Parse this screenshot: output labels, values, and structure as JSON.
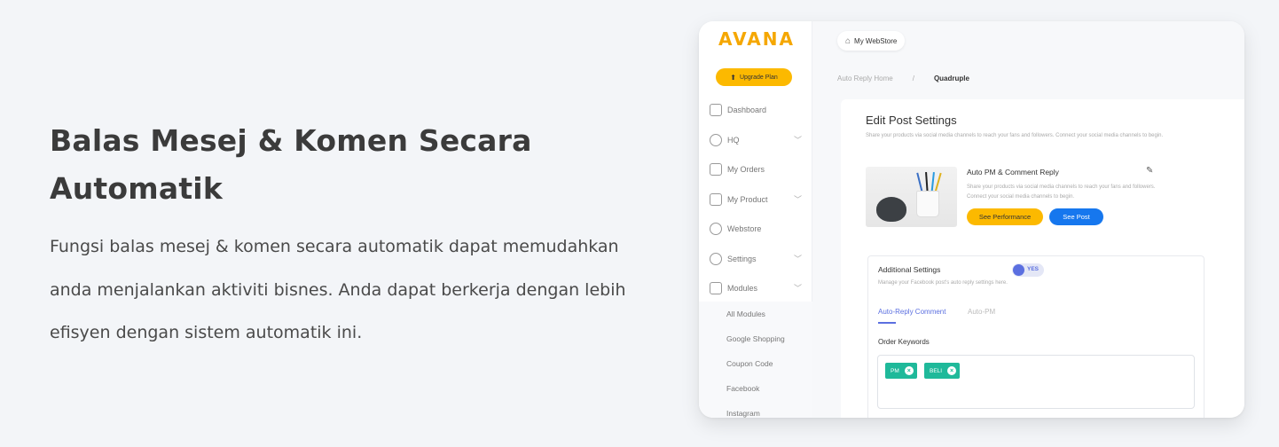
{
  "hero": {
    "title": "Balas Mesej & Komen Secara Automatik",
    "description": "Fungsi balas mesej & komen secara automatik dapat memudahkan anda menjalankan aktiviti bisnes. Anda dapat berkerja dengan lebih efisyen dengan sistem automatik ini."
  },
  "app": {
    "logo": "AVANA",
    "upgrade_label": "Upgrade Plan",
    "sidebar": [
      {
        "label": "Dashboard",
        "icon": "dashboard-icon"
      },
      {
        "label": "HQ",
        "icon": "hq-icon"
      },
      {
        "label": "My Orders",
        "icon": "orders-icon"
      },
      {
        "label": "My Product",
        "icon": "product-icon"
      },
      {
        "label": "Webstore",
        "icon": "webstore-icon"
      },
      {
        "label": "Settings",
        "icon": "gear-icon"
      },
      {
        "label": "Modules",
        "icon": "modules-icon"
      }
    ],
    "submenu": [
      "All Modules",
      "Google Shopping",
      "Coupon Code",
      "Facebook",
      "Instagram"
    ],
    "store_label": "My WebStore",
    "breadcrumb": {
      "parent": "Auto Reply Home",
      "separator": "/",
      "current": "Quadruple"
    },
    "card": {
      "title": "Edit Post Settings",
      "subtitle": "Share your products via social media channels to reach your fans and followers. Connect your social media channels to begin.",
      "post_title": "Auto PM & Comment Reply",
      "post_desc": "Share your products via social media channels to reach your fans and followers. Connect your social media channels to begin.",
      "perf_button": "See Performance",
      "post_button": "See Post"
    },
    "additional": {
      "title": "Additional Settings",
      "toggle_label": "YES",
      "subtitle": "Manage your Facebook post's auto reply settings here.",
      "tabs": [
        "Auto-Reply Comment",
        "Auto-PM"
      ],
      "keywords_label": "Order Keywords",
      "keywords": [
        "PM",
        "BELI"
      ]
    }
  }
}
